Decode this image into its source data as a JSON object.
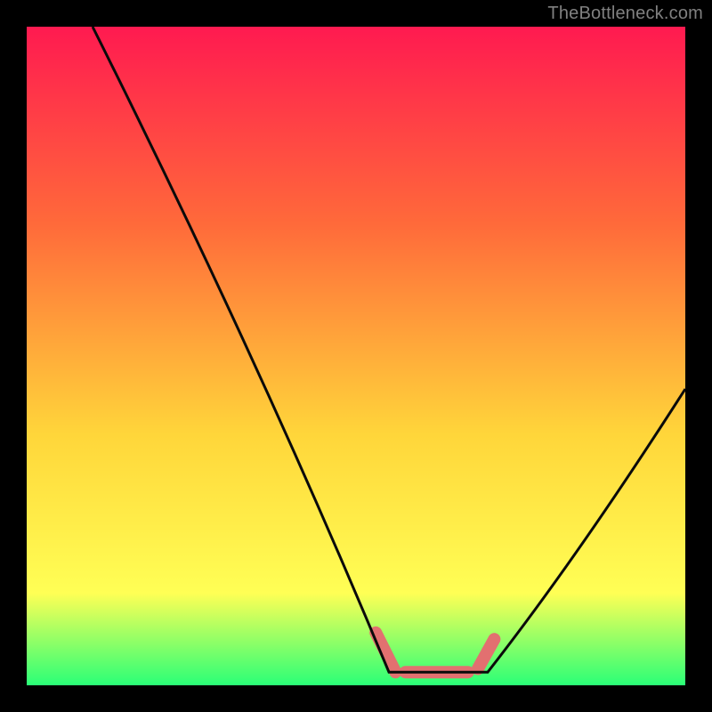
{
  "watermark": "TheBottleneck.com",
  "colors": {
    "frame": "#000000",
    "gradient_top": "#ff1a50",
    "gradient_mid1": "#ff6a3a",
    "gradient_mid2": "#ffd63a",
    "gradient_mid3": "#ffff55",
    "gradient_bottom": "#2aff77",
    "curve_stroke": "#0a0a0a",
    "highlight_fill": "#e27070"
  },
  "chart_data": {
    "type": "line",
    "title": "",
    "xlabel": "",
    "ylabel": "",
    "xlim": [
      0,
      100
    ],
    "ylim": [
      0,
      100
    ],
    "curve": {
      "left_x_start": 10,
      "left_y_start": 100,
      "valley_x_start": 55,
      "valley_x_end": 70,
      "valley_y": 2,
      "right_x_end": 100,
      "right_y_end": 45
    },
    "highlight_segments": [
      {
        "x1": 53,
        "y1": 8,
        "x2": 56,
        "y2": 2
      },
      {
        "x1": 57.5,
        "y1": 2,
        "x2": 67,
        "y2": 2
      },
      {
        "x1": 68.5,
        "y1": 2.5,
        "x2": 71,
        "y2": 7
      }
    ]
  }
}
